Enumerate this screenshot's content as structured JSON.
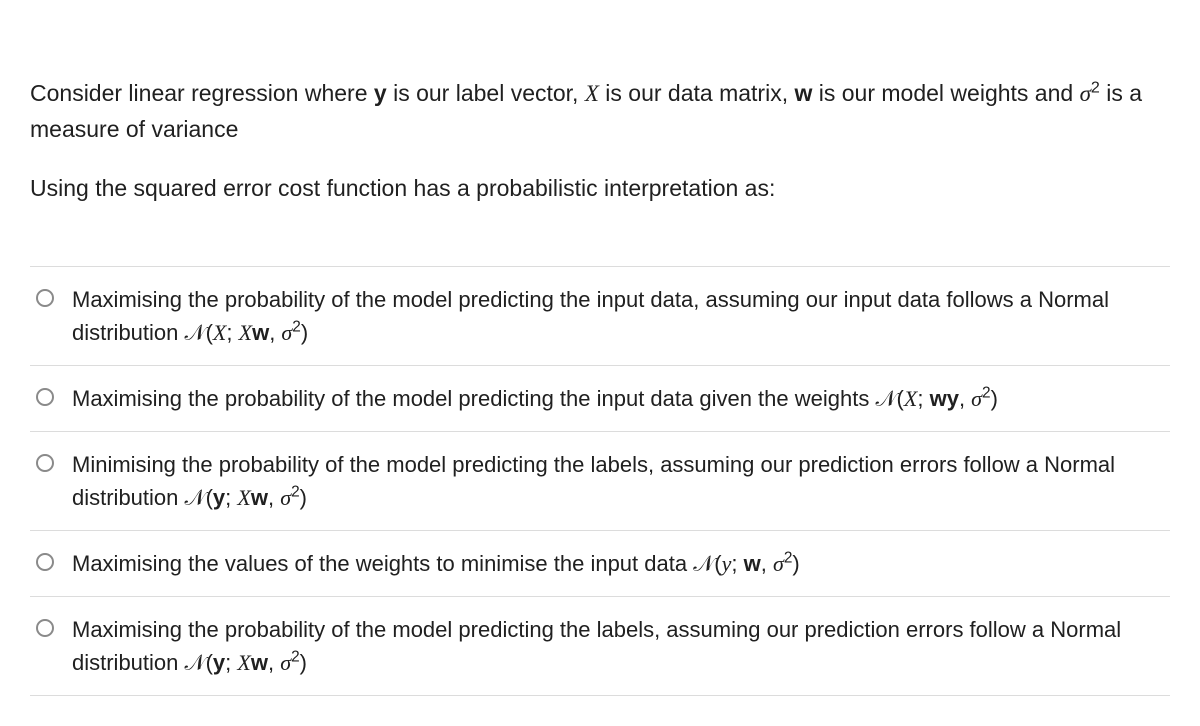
{
  "question": {
    "stem_a": "Consider linear regression where ",
    "stem_b": " is our label vector, ",
    "stem_c": " is our data matrix, ",
    "stem_d": " is our model weights and ",
    "stem_e": " is a measure of variance",
    "prompt": "Using the squared error cost function has a probabilistic interpretation as:"
  },
  "sym": {
    "y": "y",
    "X": "X",
    "w": "w",
    "sigma": "σ",
    "two": "2",
    "N": "𝒩",
    "lp": "(",
    "rp": ")",
    "semi": "; ",
    "comma": ", ",
    "y_it": "y"
  },
  "options": {
    "o1a": "Maximising the probability of the model predicting the input data, assuming our input data follows a Normal distribution ",
    "o2a": "Maximising the probability of the model predicting the input data given the weights ",
    "o3a": "Minimising the probability of the model predicting the labels, assuming our prediction errors follow a Normal distribution ",
    "o4a": "Maximising the values of the weights to minimise the input data ",
    "o5a": "Maximising the probability of the model predicting the labels, assuming our prediction errors follow a Normal distribution "
  }
}
